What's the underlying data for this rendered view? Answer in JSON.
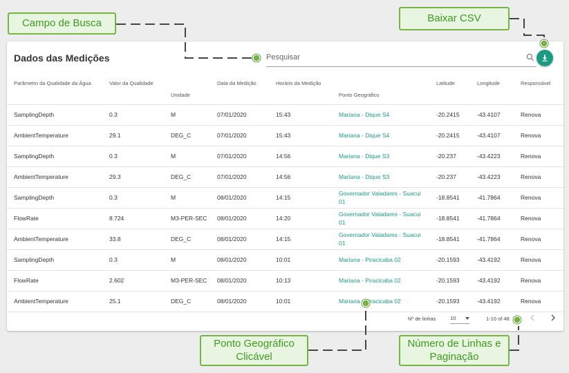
{
  "card": {
    "title": "Dados das Medições"
  },
  "search": {
    "placeholder": "Pesquisar",
    "icon": "search-icon"
  },
  "download_button": {
    "icon": "download-icon",
    "color": "#1a9b82"
  },
  "table": {
    "headers": [
      "Parâmetro da Qualidade da Água",
      "Valor da Qualidade",
      "Unidade",
      "Data da Medição",
      "Horário da Medição",
      "Ponto Geográfico",
      "Latitude",
      "Longitude",
      "Responsável"
    ],
    "rows": [
      [
        "SamplingDepth",
        "0.3",
        "M",
        "07/01/2020",
        "15:43",
        "Mariana - Dique S4",
        "-20.2415",
        "-43.4107",
        "Renova"
      ],
      [
        "AmbientTemperature",
        "29.1",
        "DEG_C",
        "07/01/2020",
        "15:43",
        "Mariana - Dique S4",
        "-20.2415",
        "-43.4107",
        "Renova"
      ],
      [
        "SamplingDepth",
        "0.3",
        "M",
        "07/01/2020",
        "14:56",
        "Mariana - Dique S3",
        "-20.237",
        "-43.4223",
        "Renova"
      ],
      [
        "AmbientTemperature",
        "29.3",
        "DEG_C",
        "07/01/2020",
        "14:56",
        "Mariana - Dique S3",
        "-20.237",
        "-43.4223",
        "Renova"
      ],
      [
        "SamplingDepth",
        "0.3",
        "M",
        "08/01/2020",
        "14:15",
        "Governador Valadares - Suacui 01",
        "-18.8541",
        "-41.7864",
        "Renova"
      ],
      [
        "FlowRate",
        "8.724",
        "M3-PER-SEC",
        "08/01/2020",
        "14:20",
        "Governador Valadares - Suacui 01",
        "-18.8541",
        "-41.7864",
        "Renova"
      ],
      [
        "AmbientTemperature",
        "33.8",
        "DEG_C",
        "08/01/2020",
        "14:15",
        "Governador Valadares - Suacui 01",
        "-18.8541",
        "-41.7864",
        "Renova"
      ],
      [
        "SamplingDepth",
        "0.3",
        "M",
        "08/01/2020",
        "10:01",
        "Mariana - Piracicaba 02",
        "-20.1593",
        "-43.4192",
        "Renova"
      ],
      [
        "FlowRate",
        "2.602",
        "M3-PER-SEC",
        "08/01/2020",
        "10:13",
        "Mariana - Piracicaba 02",
        "-20.1593",
        "-43.4192",
        "Renova"
      ],
      [
        "AmbientTemperature",
        "25.1",
        "DEG_C",
        "08/01/2020",
        "10:01",
        "Mariana - Piracicaba 02",
        "-20.1593",
        "-43.4192",
        "Renova"
      ]
    ]
  },
  "pagination": {
    "rows_label": "Nº de linhas",
    "rows_per_page": "10",
    "range": "1-10 of 48",
    "prev_icon": "chevron-left-icon",
    "next_icon": "chevron-right-icon"
  },
  "callouts": {
    "search_field": "Campo de Busca",
    "download_csv": "Baixar CSV",
    "geo_point": "Ponto Geográfico Clicável",
    "pagination": "Número de Linhas e Paginação"
  },
  "colors": {
    "accent": "#1a9b82",
    "callout_border": "#76b543",
    "callout_text": "#3f9b1f",
    "callout_bg": "#e7f5e1"
  }
}
